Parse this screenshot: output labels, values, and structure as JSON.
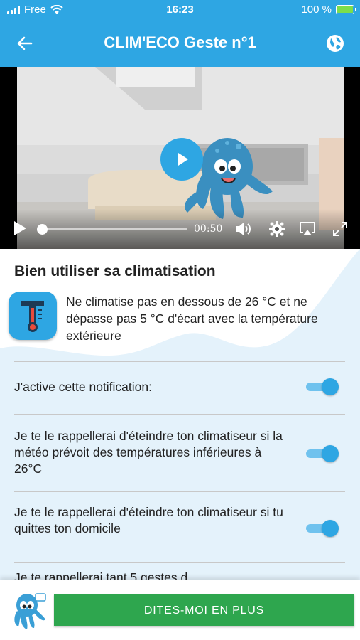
{
  "status_bar": {
    "carrier": "Free",
    "time": "16:23",
    "battery": "100 %",
    "battery_level": 1.0
  },
  "header": {
    "title": "CLIM'ECO Geste n°1",
    "back_icon": "arrow-left-icon",
    "globe_icon": "globe-icon"
  },
  "video": {
    "time": "00:50",
    "progress": 0.0
  },
  "section": {
    "title": "Bien utiliser sa climatisation",
    "tip_icon": "thermometer-icon",
    "tip_text": "Ne climatise pas en dessous de 26 °C et ne dépasse pas 5 °C d'écart avec la température extérieure"
  },
  "settings": [
    {
      "label": "J'active cette notification:",
      "enabled": true
    },
    {
      "label": "Je te le rappellerai d'éteindre ton climatiseur si la météo prévoit des températures inférieures à 26°C",
      "enabled": true
    },
    {
      "label": "Je te le rappellerai d'éteindre ton climatiseur si tu quittes ton domicile",
      "enabled": true
    }
  ],
  "partial_text": "Je te rappellerai tant 5 gestes d...",
  "footer": {
    "cta_label": "DITES-MOI EN PLUS"
  },
  "colors": {
    "primary": "#2ea6e3",
    "cta_green": "#2ea64e",
    "toggle_track": "#6fc2ee",
    "content_bg": "#e4f2fb"
  }
}
